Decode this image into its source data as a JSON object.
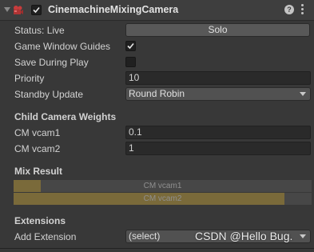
{
  "header": {
    "title": "CinemachineMixingCamera",
    "enabled": true,
    "help_glyph": "?"
  },
  "fields": {
    "status_label": "Status: Live",
    "solo_label": "Solo",
    "game_window_guides_label": "Game Window Guides",
    "game_window_guides_checked": true,
    "save_during_play_label": "Save During Play",
    "save_during_play_checked": false,
    "priority_label": "Priority",
    "priority_value": "10",
    "standby_update_label": "Standby Update",
    "standby_update_value": "Round Robin"
  },
  "child_weights": {
    "title": "Child Camera Weights",
    "items": [
      {
        "label": "CM vcam1",
        "value": "0.1"
      },
      {
        "label": "CM vcam2",
        "value": "1"
      }
    ]
  },
  "mix_result": {
    "title": "Mix Result",
    "bars": [
      {
        "label": "CM vcam1",
        "fraction": 0.09
      },
      {
        "label": "CM vcam2",
        "fraction": 0.91
      }
    ],
    "fill_color": "#7a6a3a"
  },
  "extensions": {
    "title": "Extensions",
    "add_label": "Add Extension",
    "add_value": "(select)"
  },
  "watermark": "CSDN @Hello Bug.",
  "icons": {
    "fold": "foldout-arrow-icon",
    "component": "cinemachine-camera-icon",
    "help": "help-icon",
    "menu": "kebab-menu-icon",
    "dropdown": "dropdown-caret-icon"
  }
}
